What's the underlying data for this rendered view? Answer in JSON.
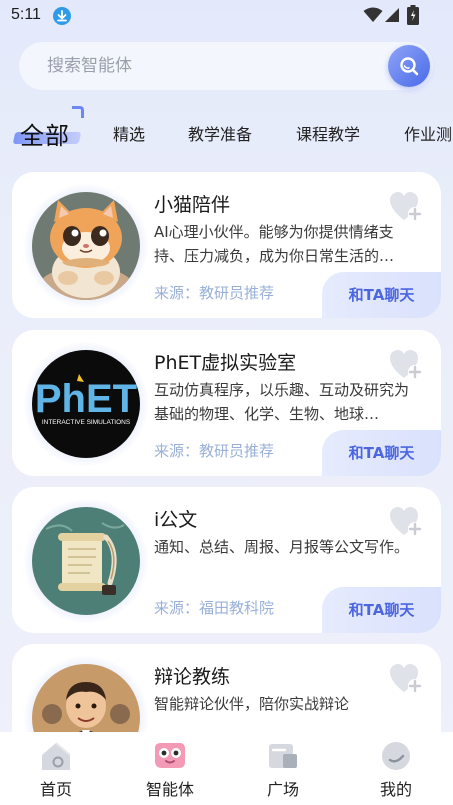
{
  "status_bar": {
    "time": "5:11"
  },
  "search": {
    "placeholder": "搜索智能体"
  },
  "tabs": {
    "active": "全部",
    "items": [
      "精选",
      "教学准备",
      "课程教学",
      "作业测"
    ]
  },
  "cards": [
    {
      "title": "小猫陪伴",
      "description": "AI心理小伙伴。能够为你提供情绪支持、压力减负，成为你日常生活的…",
      "source_prefix": "来源：",
      "source": "教研员推荐",
      "chat_label": "和TA聊天"
    },
    {
      "title": "PhET虚拟实验室",
      "description": "互动仿真程序，以乐趣、互动及研究为基础的物理、化学、生物、地球…",
      "source_prefix": "来源：",
      "source": "教研员推荐",
      "chat_label": "和TA聊天",
      "logo_text": "PhET",
      "logo_subtext": "INTERACTIVE SIMULATIONS"
    },
    {
      "title": "i公文",
      "description": "通知、总结、周报、月报等公文写作。",
      "source_prefix": "来源：",
      "source": "福田教科院",
      "chat_label": "和TA聊天"
    },
    {
      "title": "辩论教练",
      "description": "智能辩论伙伴，陪你实战辩论"
    }
  ],
  "bottom_nav": [
    {
      "label": "首页",
      "icon": "home-icon"
    },
    {
      "label": "智能体",
      "icon": "agent-icon",
      "active": true
    },
    {
      "label": "广场",
      "icon": "plaza-icon"
    },
    {
      "label": "我的",
      "icon": "profile-icon"
    }
  ],
  "colors": {
    "accent": "#4c66e0",
    "source_text": "#9ab0d8",
    "background": "#e8ecfa"
  }
}
